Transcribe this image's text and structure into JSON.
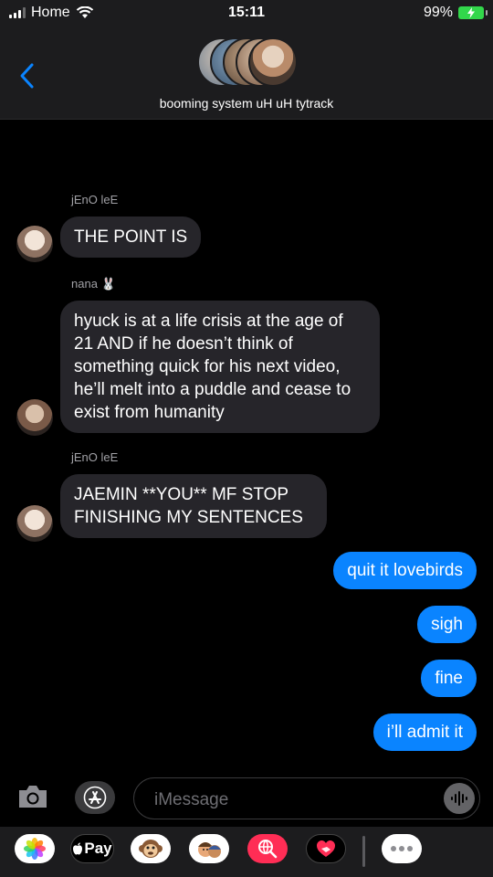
{
  "status_bar": {
    "carrier": "Home",
    "time": "15:11",
    "battery": "99%"
  },
  "header": {
    "group_name": "booming system uH uH tytrack"
  },
  "messages": [
    {
      "sender": "jEnO leE",
      "text": "THE POINT IS"
    },
    {
      "sender": "nana 🐰",
      "text": "hyuck is at a life crisis at the age of 21 AND if he doesn’t think of something quick for his next video, he’ll melt into a puddle and cease to exist from humanity"
    },
    {
      "sender": "jEnO leE",
      "text": "JAEMIN **YOU** MF STOP FINISHING MY SENTENCES"
    },
    {
      "text": "quit it lovebirds"
    },
    {
      "text": "sigh"
    },
    {
      "text": "fine"
    },
    {
      "text": "i’ll admit it"
    }
  ],
  "compose": {
    "placeholder": "iMessage"
  },
  "app_strip": {
    "apple_pay_label": "Pay"
  },
  "colors": {
    "outgoing_bubble": "#0a84ff",
    "incoming_bubble": "#26252a",
    "header_bg": "#1c1c1e",
    "battery": "#32d74b"
  }
}
